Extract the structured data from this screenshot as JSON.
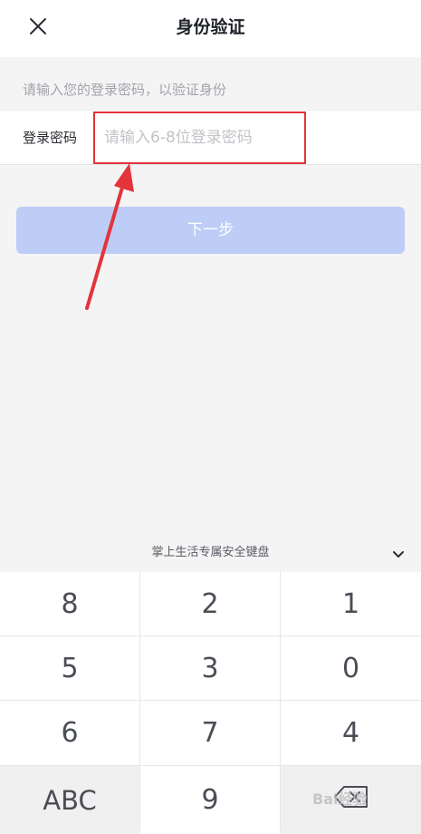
{
  "header": {
    "title": "身份验证",
    "close_icon": "close-icon"
  },
  "form": {
    "hint": "请输入您的登录密码，以验证身份",
    "password_label": "登录密码",
    "password_placeholder": "请输入6-8位登录密码",
    "password_value": ""
  },
  "next_button": {
    "label": "下一步",
    "color": "#bdcdf6"
  },
  "annotation": {
    "color": "#e3343b"
  },
  "keyboard": {
    "title": "掌上生活专属安全键盘",
    "collapse_icon": "chevron-down-icon",
    "keys": [
      {
        "label": "8"
      },
      {
        "label": "2"
      },
      {
        "label": "1"
      },
      {
        "label": "5"
      },
      {
        "label": "3"
      },
      {
        "label": "0"
      },
      {
        "label": "6"
      },
      {
        "label": "7"
      },
      {
        "label": "4"
      },
      {
        "label": "ABC"
      },
      {
        "label": "9"
      },
      {
        "label": "",
        "icon": "backspace-icon"
      }
    ]
  },
  "watermark": {
    "text": "Bai经验"
  }
}
